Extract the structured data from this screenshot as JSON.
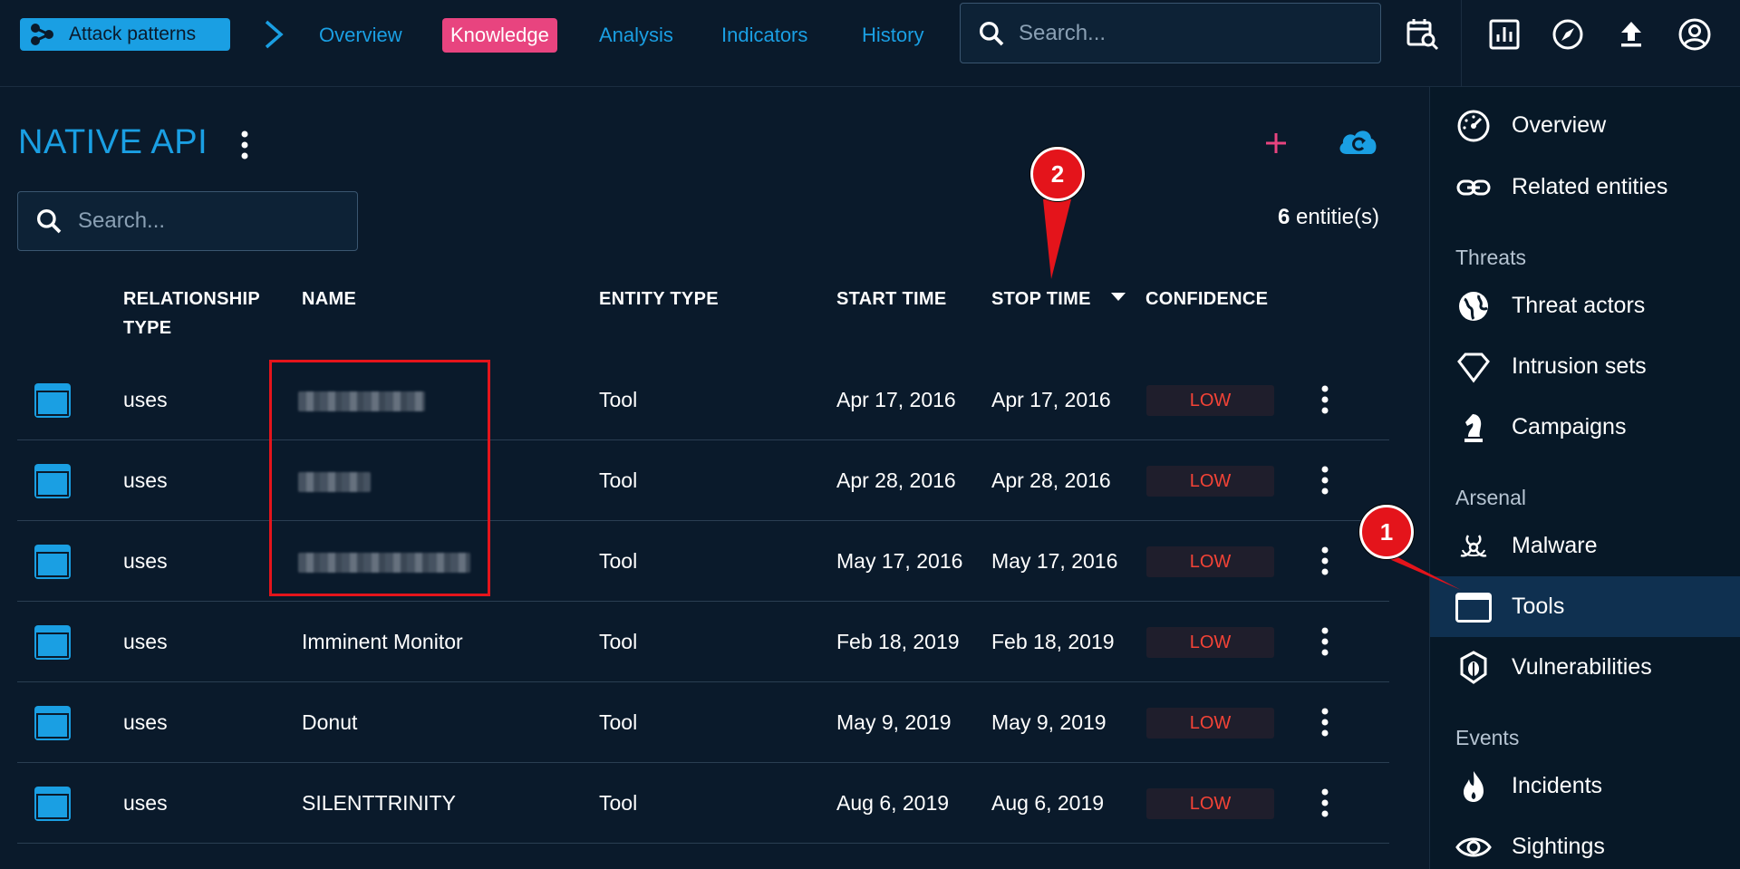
{
  "topbar": {
    "entity_chip": "Attack patterns",
    "tabs": [
      {
        "label": "Overview",
        "active": false
      },
      {
        "label": "Knowledge",
        "active": true
      },
      {
        "label": "Analysis",
        "active": false
      },
      {
        "label": "Indicators",
        "active": false
      },
      {
        "label": "History",
        "active": false
      }
    ],
    "search_placeholder": "Search...",
    "icons": [
      "calendar-search-icon",
      "dashboard-icon",
      "compass-icon",
      "upload-icon",
      "account-icon"
    ]
  },
  "main": {
    "title": "NATIVE API",
    "search_placeholder": "Search...",
    "count_number": "6",
    "count_suffix": " entitie(s)",
    "columns": {
      "relationship_type_1": "RELATIONSHIP",
      "relationship_type_2": "TYPE",
      "name": "NAME",
      "entity_type": "ENTITY TYPE",
      "start_time": "START TIME",
      "stop_time": "STOP TIME",
      "confidence": "CONFIDENCE"
    },
    "rows": [
      {
        "relationship": "uses",
        "name": "",
        "redacted": true,
        "entity_type": "Tool",
        "start": "Apr 17, 2016",
        "stop": "Apr 17, 2016",
        "confidence": "LOW"
      },
      {
        "relationship": "uses",
        "name": "",
        "redacted": true,
        "entity_type": "Tool",
        "start": "Apr 28, 2016",
        "stop": "Apr 28, 2016",
        "confidence": "LOW"
      },
      {
        "relationship": "uses",
        "name": "",
        "redacted": true,
        "entity_type": "Tool",
        "start": "May 17, 2016",
        "stop": "May 17, 2016",
        "confidence": "LOW"
      },
      {
        "relationship": "uses",
        "name": "Imminent Monitor",
        "redacted": false,
        "entity_type": "Tool",
        "start": "Feb 18, 2019",
        "stop": "Feb 18, 2019",
        "confidence": "LOW"
      },
      {
        "relationship": "uses",
        "name": "Donut",
        "redacted": false,
        "entity_type": "Tool",
        "start": "May 9, 2019",
        "stop": "May 9, 2019",
        "confidence": "LOW"
      },
      {
        "relationship": "uses",
        "name": "SILENTTRINITY",
        "redacted": false,
        "entity_type": "Tool",
        "start": "Aug 6, 2019",
        "stop": "Aug 6, 2019",
        "confidence": "LOW"
      }
    ]
  },
  "sidebar": {
    "items_top": [
      {
        "label": "Overview",
        "icon": "gauge-icon"
      },
      {
        "label": "Related entities",
        "icon": "link-icon"
      }
    ],
    "threats_heading": "Threats",
    "threats": [
      {
        "label": "Threat actors",
        "icon": "globe-icon"
      },
      {
        "label": "Intrusion sets",
        "icon": "diamond-icon"
      },
      {
        "label": "Campaigns",
        "icon": "chess-knight-icon"
      }
    ],
    "arsenal_heading": "Arsenal",
    "arsenal": [
      {
        "label": "Malware",
        "icon": "biohazard-icon"
      },
      {
        "label": "Tools",
        "icon": "tool-window-icon",
        "active": true
      },
      {
        "label": "Vulnerabilities",
        "icon": "bug-icon"
      }
    ],
    "events_heading": "Events",
    "events": [
      {
        "label": "Incidents",
        "icon": "fire-icon"
      },
      {
        "label": "Sightings",
        "icon": "eye-icon"
      }
    ]
  },
  "annotations": {
    "callout_1": "1",
    "callout_2": "2"
  },
  "colors": {
    "background": "#0a1a2b",
    "accent": "#1a9fe3",
    "active_tab": "#e8447f",
    "confidence_low": "#f44336",
    "annotation": "#e4141b"
  }
}
